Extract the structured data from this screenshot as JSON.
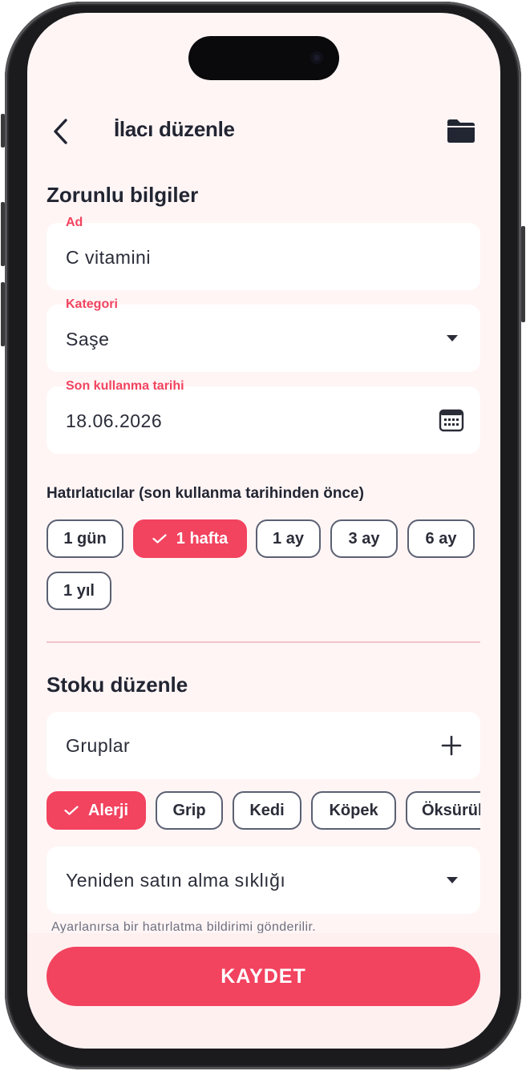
{
  "header": {
    "title": "İlacı düzenle",
    "back_icon": "chevron-left-icon",
    "folder_icon": "folder-icon"
  },
  "required": {
    "heading": "Zorunlu bilgiler",
    "name_field": {
      "label": "Ad",
      "value": "C vitamini"
    },
    "category_field": {
      "label": "Kategori",
      "value": "Saşe"
    },
    "expiry_field": {
      "label": "Son kullanma tarihi",
      "value": "18.06.2026"
    }
  },
  "reminders": {
    "heading": "Hatırlatıcılar (son kullanma tarihinden önce)",
    "chips": [
      {
        "label": "1 gün",
        "selected": false
      },
      {
        "label": "1 hafta",
        "selected": true
      },
      {
        "label": "1 ay",
        "selected": false
      },
      {
        "label": "3 ay",
        "selected": false
      },
      {
        "label": "6 ay",
        "selected": false
      },
      {
        "label": "1 yıl",
        "selected": false
      }
    ]
  },
  "stock": {
    "heading": "Stoku düzenle",
    "groups_field": {
      "value": "Gruplar"
    },
    "group_chips": [
      {
        "label": "Alerji",
        "selected": true
      },
      {
        "label": "Grip",
        "selected": false
      },
      {
        "label": "Kedi",
        "selected": false
      },
      {
        "label": "Köpek",
        "selected": false
      },
      {
        "label": "Öksürük",
        "selected": false
      }
    ],
    "repurchase_field": {
      "value": "Yeniden satın alma sıklığı"
    },
    "hint": "Ayarlanırsa bir hatırlatma bildirimi gönderilir."
  },
  "save": {
    "label": "KAYDET"
  },
  "colors": {
    "accent": "#f2435f",
    "background": "#fff5f5",
    "text": "#222532"
  }
}
